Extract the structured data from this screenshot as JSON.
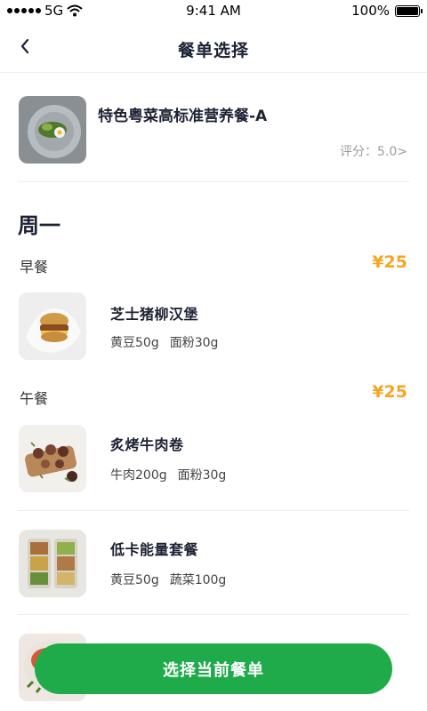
{
  "status_bar": {
    "carrier": "5G",
    "time": "9:41 AM",
    "battery": "100%"
  },
  "nav": {
    "title": "餐单选择"
  },
  "plan": {
    "name": "特色粤菜高标准营养餐-A",
    "rating": "评分：5.0>"
  },
  "day": "周一",
  "meals": [
    {
      "label": "早餐",
      "price": "¥25",
      "dishes": [
        {
          "name": "芝士猪柳汉堡",
          "ingredients": [
            "黄豆50g",
            "面粉30g"
          ]
        }
      ]
    },
    {
      "label": "午餐",
      "price": "¥25",
      "dishes": [
        {
          "name": "炙烤牛肉卷",
          "ingredients": [
            "牛肉200g",
            "面粉30g"
          ]
        },
        {
          "name": "低卡能量套餐",
          "ingredients": [
            "黄豆50g",
            "蔬菜100g"
          ]
        }
      ]
    }
  ],
  "cta_label": "选择当前餐单",
  "colors": {
    "accent_green": "#20ab4a",
    "price_orange": "#f5a623"
  }
}
